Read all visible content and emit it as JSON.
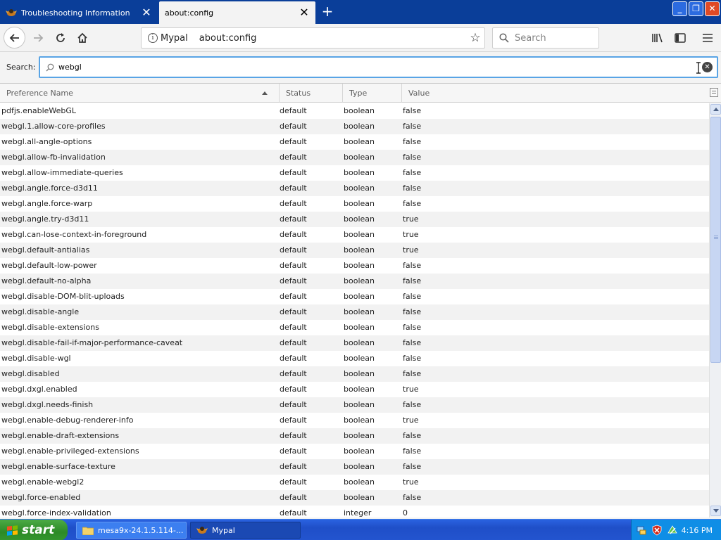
{
  "browser": {
    "tabs": [
      {
        "label": "Troubleshooting Information",
        "active": false
      },
      {
        "label": "about:config",
        "active": true
      }
    ],
    "new_tab_icon": "plus-icon",
    "window_buttons": [
      "minimize-icon",
      "maximize-icon",
      "close-icon"
    ]
  },
  "navbar": {
    "identity_label": "Mypal",
    "url": "about:config",
    "search_placeholder": "Search",
    "icons": [
      "back-arrow-icon",
      "forward-arrow-icon",
      "reload-icon",
      "home-icon",
      "bookmark-star-icon",
      "library-icon",
      "sidebar-icon",
      "hamburger-menu-icon"
    ]
  },
  "filter": {
    "label": "Search:",
    "value": "webgl"
  },
  "table": {
    "columns": [
      "Preference Name",
      "Status",
      "Type",
      "Value"
    ],
    "sorted_by": "Preference Name",
    "rows": [
      {
        "name": "pdfjs.enableWebGL",
        "status": "default",
        "type": "boolean",
        "value": "false"
      },
      {
        "name": "webgl.1.allow-core-profiles",
        "status": "default",
        "type": "boolean",
        "value": "false"
      },
      {
        "name": "webgl.all-angle-options",
        "status": "default",
        "type": "boolean",
        "value": "false"
      },
      {
        "name": "webgl.allow-fb-invalidation",
        "status": "default",
        "type": "boolean",
        "value": "false"
      },
      {
        "name": "webgl.allow-immediate-queries",
        "status": "default",
        "type": "boolean",
        "value": "false"
      },
      {
        "name": "webgl.angle.force-d3d11",
        "status": "default",
        "type": "boolean",
        "value": "false"
      },
      {
        "name": "webgl.angle.force-warp",
        "status": "default",
        "type": "boolean",
        "value": "false"
      },
      {
        "name": "webgl.angle.try-d3d11",
        "status": "default",
        "type": "boolean",
        "value": "true"
      },
      {
        "name": "webgl.can-lose-context-in-foreground",
        "status": "default",
        "type": "boolean",
        "value": "true"
      },
      {
        "name": "webgl.default-antialias",
        "status": "default",
        "type": "boolean",
        "value": "true"
      },
      {
        "name": "webgl.default-low-power",
        "status": "default",
        "type": "boolean",
        "value": "false"
      },
      {
        "name": "webgl.default-no-alpha",
        "status": "default",
        "type": "boolean",
        "value": "false"
      },
      {
        "name": "webgl.disable-DOM-blit-uploads",
        "status": "default",
        "type": "boolean",
        "value": "false"
      },
      {
        "name": "webgl.disable-angle",
        "status": "default",
        "type": "boolean",
        "value": "false"
      },
      {
        "name": "webgl.disable-extensions",
        "status": "default",
        "type": "boolean",
        "value": "false"
      },
      {
        "name": "webgl.disable-fail-if-major-performance-caveat",
        "status": "default",
        "type": "boolean",
        "value": "false"
      },
      {
        "name": "webgl.disable-wgl",
        "status": "default",
        "type": "boolean",
        "value": "false"
      },
      {
        "name": "webgl.disabled",
        "status": "default",
        "type": "boolean",
        "value": "false"
      },
      {
        "name": "webgl.dxgl.enabled",
        "status": "default",
        "type": "boolean",
        "value": "true"
      },
      {
        "name": "webgl.dxgl.needs-finish",
        "status": "default",
        "type": "boolean",
        "value": "false"
      },
      {
        "name": "webgl.enable-debug-renderer-info",
        "status": "default",
        "type": "boolean",
        "value": "true"
      },
      {
        "name": "webgl.enable-draft-extensions",
        "status": "default",
        "type": "boolean",
        "value": "false"
      },
      {
        "name": "webgl.enable-privileged-extensions",
        "status": "default",
        "type": "boolean",
        "value": "false"
      },
      {
        "name": "webgl.enable-surface-texture",
        "status": "default",
        "type": "boolean",
        "value": "false"
      },
      {
        "name": "webgl.enable-webgl2",
        "status": "default",
        "type": "boolean",
        "value": "true"
      },
      {
        "name": "webgl.force-enabled",
        "status": "default",
        "type": "boolean",
        "value": "false"
      },
      {
        "name": "webgl.force-index-validation",
        "status": "default",
        "type": "integer",
        "value": "0"
      }
    ]
  },
  "taskbar": {
    "start_label": "start",
    "tasks": [
      {
        "label": "mesa9x-24.1.5.114-...",
        "icon": "folder-icon",
        "active": true
      },
      {
        "label": "Mypal",
        "icon": "mypal-icon",
        "active": false
      }
    ],
    "tray_icons": [
      "network-icon",
      "security-shield-icon",
      "update-icon"
    ],
    "clock": "4:16 PM"
  },
  "colors": {
    "titlebar": "#0a3e99",
    "accent_focus": "#59a4e5",
    "taskbar": "#2354cf",
    "start_button": "#35962f"
  }
}
